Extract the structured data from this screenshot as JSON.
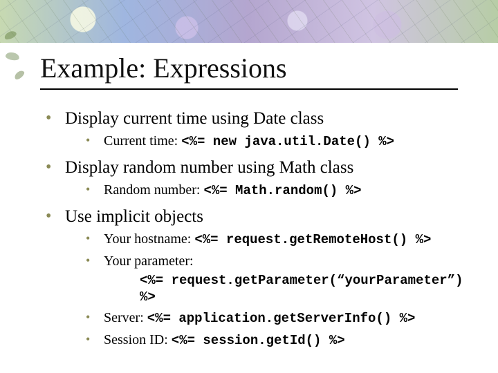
{
  "title": "Example: Expressions",
  "bullets": {
    "b1": {
      "text": "Display current time using Date class",
      "sub1": {
        "label": "Current time: ",
        "code": "<%= new java.util.Date() %>"
      }
    },
    "b2": {
      "text": "Display random number using Math class",
      "sub1": {
        "label": "Random number: ",
        "code": "<%= Math.random() %>"
      }
    },
    "b3": {
      "text": "Use implicit objects",
      "sub1": {
        "label": "Your hostname: ",
        "code": "<%= request.getRemoteHost() %>"
      },
      "sub2": {
        "label": "Your parameter:",
        "code_line": "<%= request.getParameter(“yourParameter”) %>"
      },
      "sub3": {
        "label": "Server: ",
        "code": "<%= application.getServerInfo() %>"
      },
      "sub4": {
        "label": "Session ID: ",
        "code": "<%= session.getId() %>"
      }
    }
  }
}
